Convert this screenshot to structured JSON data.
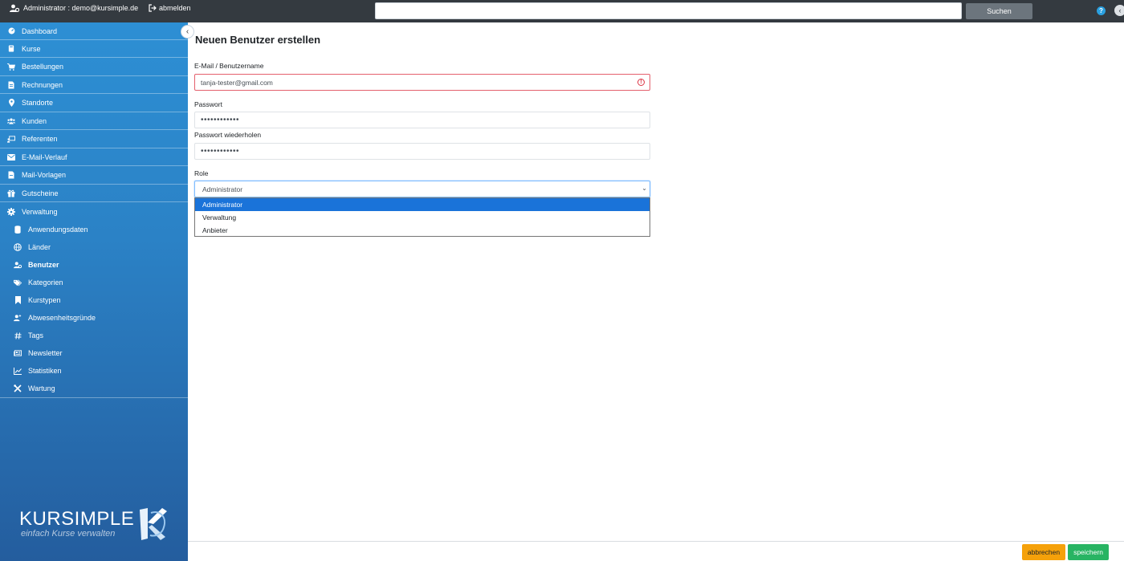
{
  "topbar": {
    "user_label": "Administrator : demo@kursimple.de",
    "logout_label": "abmelden",
    "search_placeholder": "",
    "search_button": "Suchen",
    "help_glyph": "?"
  },
  "sidebar": {
    "items": [
      {
        "label": "Dashboard",
        "icon": "dashboard-icon"
      },
      {
        "label": "Kurse",
        "icon": "book-icon"
      },
      {
        "label": "Bestellungen",
        "icon": "cart-icon"
      },
      {
        "label": "Rechnungen",
        "icon": "invoice-icon"
      },
      {
        "label": "Standorte",
        "icon": "map-marker-icon"
      },
      {
        "label": "Kunden",
        "icon": "users-icon"
      },
      {
        "label": "Referenten",
        "icon": "presenter-icon"
      },
      {
        "label": "E-Mail-Verlauf",
        "icon": "envelope-icon"
      },
      {
        "label": "Mail-Vorlagen",
        "icon": "file-icon"
      },
      {
        "label": "Gutscheine",
        "icon": "gift-icon"
      },
      {
        "label": "Verwaltung",
        "icon": "gear-icon"
      }
    ],
    "subitems": [
      {
        "label": "Anwendungsdaten",
        "icon": "database-icon"
      },
      {
        "label": "Länder",
        "icon": "globe-icon"
      },
      {
        "label": "Benutzer",
        "icon": "user-gear-icon",
        "active": true
      },
      {
        "label": "Kategorien",
        "icon": "tags-icon"
      },
      {
        "label": "Kurstypen",
        "icon": "bookmark-icon"
      },
      {
        "label": "Abwesenheitsgründe",
        "icon": "user-clock-icon"
      },
      {
        "label": "Tags",
        "icon": "hashtag-icon"
      },
      {
        "label": "Newsletter",
        "icon": "newspaper-icon"
      },
      {
        "label": "Statistiken",
        "icon": "chart-icon"
      },
      {
        "label": "Wartung",
        "icon": "tools-icon"
      }
    ],
    "brand_name": "KURSIMPLE",
    "brand_tagline": "einfach Kurse verwalten"
  },
  "form": {
    "title": "Neuen Benutzer erstellen",
    "email_label": "E-Mail / Benutzername",
    "email_value": "tanja-tester@gmail.com",
    "password_label": "Passwort",
    "password_value": "••••••••••••",
    "password_repeat_label": "Passwort wiederholen",
    "password_repeat_value": "••••••••••••",
    "role_label": "Role",
    "role_value": "Administrator",
    "role_options": [
      "Administrator",
      "Verwaltung",
      "Anbieter"
    ],
    "role_selected_index": 0
  },
  "footer": {
    "cancel_label": "abbrechen",
    "save_label": "speichern"
  },
  "colors": {
    "topbar": "#343a40",
    "sidebar_top": "#2d8fd4",
    "sidebar_bottom": "#245d9e",
    "cancel": "#f5a10a",
    "save": "#28b463",
    "option_selected": "#1a73d9",
    "error": "#dc3545"
  }
}
